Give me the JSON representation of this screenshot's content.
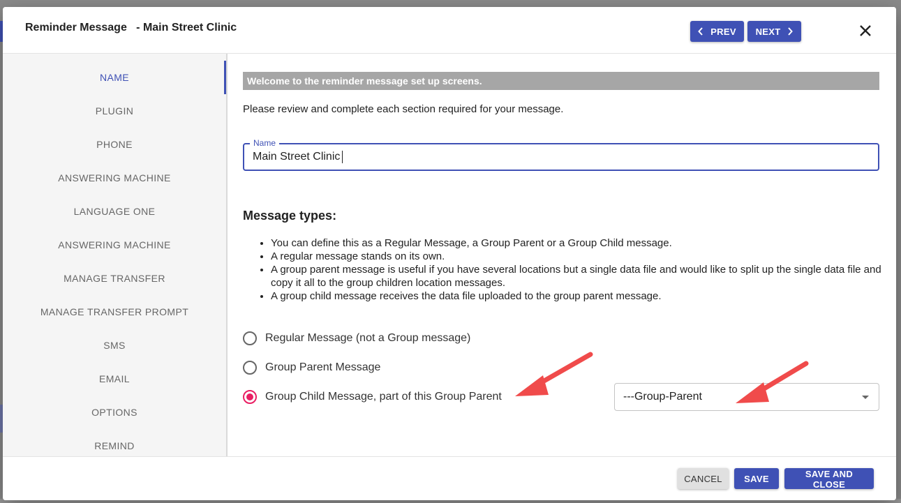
{
  "dialog": {
    "title": "Reminder Message   - Main Street Clinic",
    "prev_label": "PREV",
    "next_label": "NEXT"
  },
  "sidebar": {
    "items": [
      {
        "label": "NAME",
        "active": true
      },
      {
        "label": "PLUGIN"
      },
      {
        "label": "PHONE"
      },
      {
        "label": "ANSWERING MACHINE"
      },
      {
        "label": "LANGUAGE ONE"
      },
      {
        "label": "ANSWERING MACHINE"
      },
      {
        "label": "MANAGE TRANSFER"
      },
      {
        "label": "MANAGE TRANSFER PROMPT"
      },
      {
        "label": "SMS"
      },
      {
        "label": "EMAIL"
      },
      {
        "label": "OPTIONS"
      },
      {
        "label": "REMIND"
      }
    ]
  },
  "main": {
    "welcome": "Welcome to the reminder message set up screens.",
    "intro": "Please review and complete each section required for your message.",
    "name_field": {
      "label": "Name",
      "value": "Main Street Clinic"
    },
    "types_title": "Message types:",
    "bullets": [
      "You can define this as a Regular Message, a Group Parent or a Group Child message.",
      "A regular message stands on its own.",
      "A group parent message is useful if you have several locations but a single data file and would like to split up the single data file and copy it all to the group children location messages.",
      "A group child message receives the data file uploaded to the group parent message."
    ],
    "radios": [
      {
        "label": "Regular Message (not a Group message)",
        "checked": false
      },
      {
        "label": "Group Parent Message",
        "checked": false
      },
      {
        "label": "Group Child Message, part of this Group Parent",
        "checked": true
      }
    ],
    "group_parent_select": "---Group-Parent"
  },
  "footer": {
    "cancel_label": "CANCEL",
    "save_label": "SAVE",
    "save_close_label": "SAVE AND CLOSE"
  },
  "colors": {
    "primary": "#3f51b5",
    "radio_checked": "#e91e63",
    "annotation_arrow": "#f04b4b"
  }
}
